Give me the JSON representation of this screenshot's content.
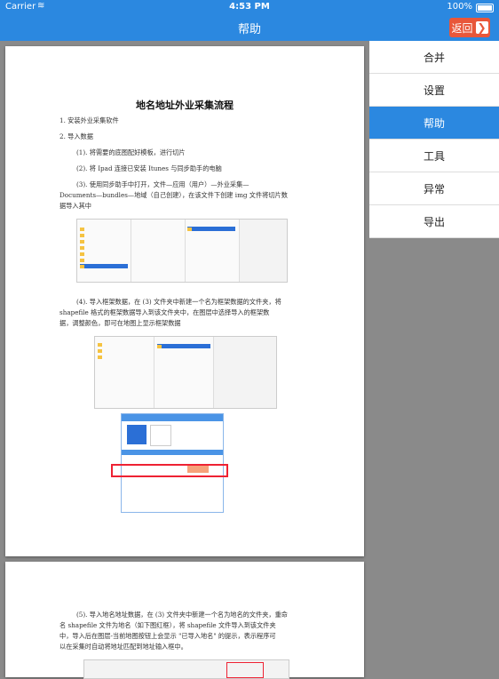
{
  "status_bar": {
    "carrier": "Carrier",
    "time": "4:53 PM",
    "battery": "100%"
  },
  "nav": {
    "title": "帮助",
    "back_label": "返回",
    "back_chevron": "❯"
  },
  "menu": {
    "items": [
      {
        "label": "合并",
        "active": false
      },
      {
        "label": "设置",
        "active": false
      },
      {
        "label": "帮助",
        "active": true
      },
      {
        "label": "工具",
        "active": false
      },
      {
        "label": "异常",
        "active": false
      },
      {
        "label": "导出",
        "active": false
      }
    ]
  },
  "document": {
    "title": "地名地址外业采集流程",
    "step1": "1. 安装外业采集软件",
    "step2": "2. 导入数据",
    "step2_1": "(1). 将需要的底图配好模板，进行切片",
    "step2_2": "(2). 将 Ipad 连接已安装 Itunes 与同步助手的电脑",
    "step2_3_line1": "(3). 使用同步助手中打开，文件—应用（用户）—外业采集—",
    "step2_3_line2": "Documents—bundles—地域（自己创建），在该文件下创建 img 文件将切片数",
    "step2_3_line3": "据导入其中",
    "step2_4_line1": "(4). 导入框架数据，在 (3) 文件夹中新建一个名为框架数据的文件夹，将",
    "step2_4_line2": "shapefile 格式的框架数据导入到该文件夹中，在图层中选择导入的框架数",
    "step2_4_line3": "据，调整颜色，即可在地图上显示框架数据",
    "step2_5_line1": "(5). 导入地名地址数据，在 (3) 文件夹中新建一个名为地名的文件夹，重命",
    "step2_5_line2": "名 shapefile 文件为地名（如下图红框），将 shapefile 文件导入到该文件夹",
    "step2_5_line3": "中，导入后在图层-当前地图按钮上会显示 \"已导入地名\" 的提示，表示程序可",
    "step2_5_line4": "以在采集时自动将地址匹配到地址输入框中。"
  }
}
